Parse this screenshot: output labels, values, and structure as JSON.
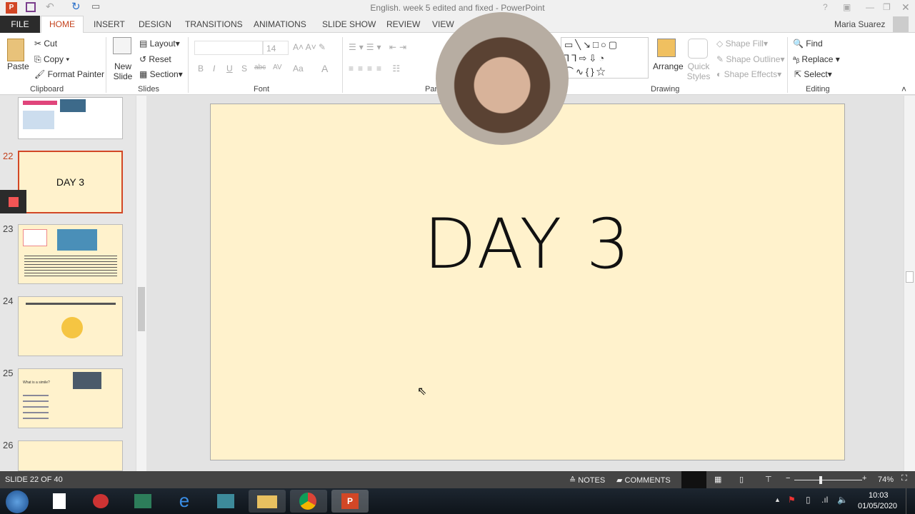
{
  "window": {
    "title": "English. week 5 edited and fixed - PowerPoint",
    "user": "Maria Suarez"
  },
  "tabs": [
    "FILE",
    "HOME",
    "INSERT",
    "DESIGN",
    "TRANSITIONS",
    "ANIMATIONS",
    "SLIDE SHOW",
    "REVIEW",
    "VIEW"
  ],
  "clipboard": {
    "paste": "Paste",
    "cut": "Cut",
    "copy": "Copy",
    "format_painter": "Format Painter",
    "group": "Clipboard"
  },
  "slides_grp": {
    "new_slide": "New Slide",
    "layout": "Layout",
    "reset": "Reset",
    "section": "Section",
    "group": "Slides"
  },
  "font": {
    "size": "14",
    "group": "Font",
    "buttons": [
      "B",
      "I",
      "U",
      "S",
      "abc",
      "AV",
      "Aa",
      "A"
    ]
  },
  "paragraph": {
    "group": "Par"
  },
  "drawing": {
    "arrange": "Arrange",
    "quick_styles": "Quick Styles",
    "shape_fill": "Shape Fill",
    "shape_outline": "Shape Outline",
    "shape_effects": "Shape Effects",
    "group": "Drawing"
  },
  "editing": {
    "find": "Find",
    "replace": "Replace",
    "select": "Select",
    "group": "Editing"
  },
  "thumbs": [
    {
      "num": "22",
      "title": "DAY 3"
    },
    {
      "num": "23"
    },
    {
      "num": "24"
    },
    {
      "num": "25",
      "title": "What is a simile?"
    },
    {
      "num": "26"
    }
  ],
  "slide": {
    "text": "DAY 3"
  },
  "status": {
    "slide_info": "SLIDE 22 OF 40",
    "notes": "NOTES",
    "comments": "COMMENTS",
    "zoom": "74%",
    "zoom_fraction": 0.37
  },
  "taskbar": {
    "time": "10:03",
    "date": "01/05/2020"
  }
}
